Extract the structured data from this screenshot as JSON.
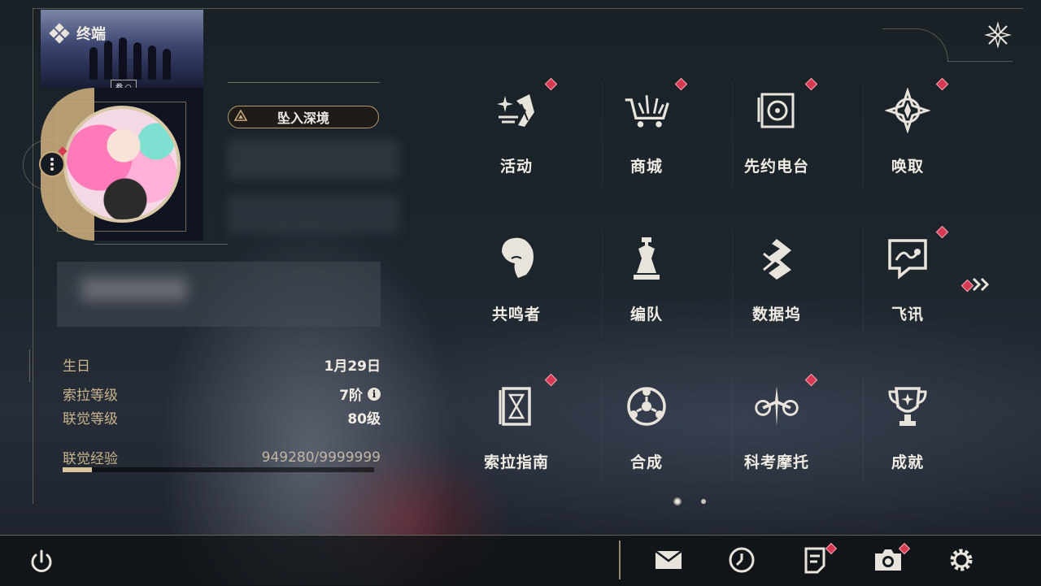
{
  "header": {
    "title": "终端"
  },
  "banner": {
    "tag": "参 ○"
  },
  "profile": {
    "abyss_button": "坠入深境",
    "stats": [
      {
        "label": "生日",
        "value": "1月29日"
      },
      {
        "label": "索拉等级",
        "value": "7阶"
      },
      {
        "label": "联觉等级",
        "value": "80级"
      }
    ],
    "exp": {
      "label": "联觉经验",
      "value": "949280/9999999",
      "progress": 0.095
    }
  },
  "menu": {
    "items": [
      {
        "label": "活动",
        "icon": "sparkle-event-icon",
        "badge": true
      },
      {
        "label": "商城",
        "icon": "shopping-cart-icon",
        "badge": true
      },
      {
        "label": "先约电台",
        "icon": "radio-icon",
        "badge": true
      },
      {
        "label": "唤取",
        "icon": "compass-star-icon",
        "badge": true
      },
      {
        "label": "共鸣者",
        "icon": "character-portrait-icon",
        "badge": false
      },
      {
        "label": "编队",
        "icon": "chess-team-icon",
        "badge": false
      },
      {
        "label": "数据坞",
        "icon": "data-dock-icon",
        "badge": false
      },
      {
        "label": "飞讯",
        "icon": "message-bubble-icon",
        "badge": true
      },
      {
        "label": "索拉指南",
        "icon": "guide-book-icon",
        "badge": true
      },
      {
        "label": "合成",
        "icon": "synthesis-icon",
        "badge": false
      },
      {
        "label": "科考摩托",
        "icon": "motorcycle-icon",
        "badge": true
      },
      {
        "label": "成就",
        "icon": "trophy-icon",
        "badge": false
      }
    ],
    "page": 1,
    "page_count": 2
  },
  "colors": {
    "accent": "#c8aa7a",
    "badge": "#d63a52",
    "text": "#f0ece4"
  },
  "bottom_bar": {
    "buttons": [
      {
        "name": "mail-icon",
        "badge": false
      },
      {
        "name": "clock-icon",
        "badge": false
      },
      {
        "name": "notice-icon",
        "badge": true
      },
      {
        "name": "camera-icon",
        "badge": true
      },
      {
        "name": "settings-gear-icon",
        "badge": false
      }
    ]
  }
}
